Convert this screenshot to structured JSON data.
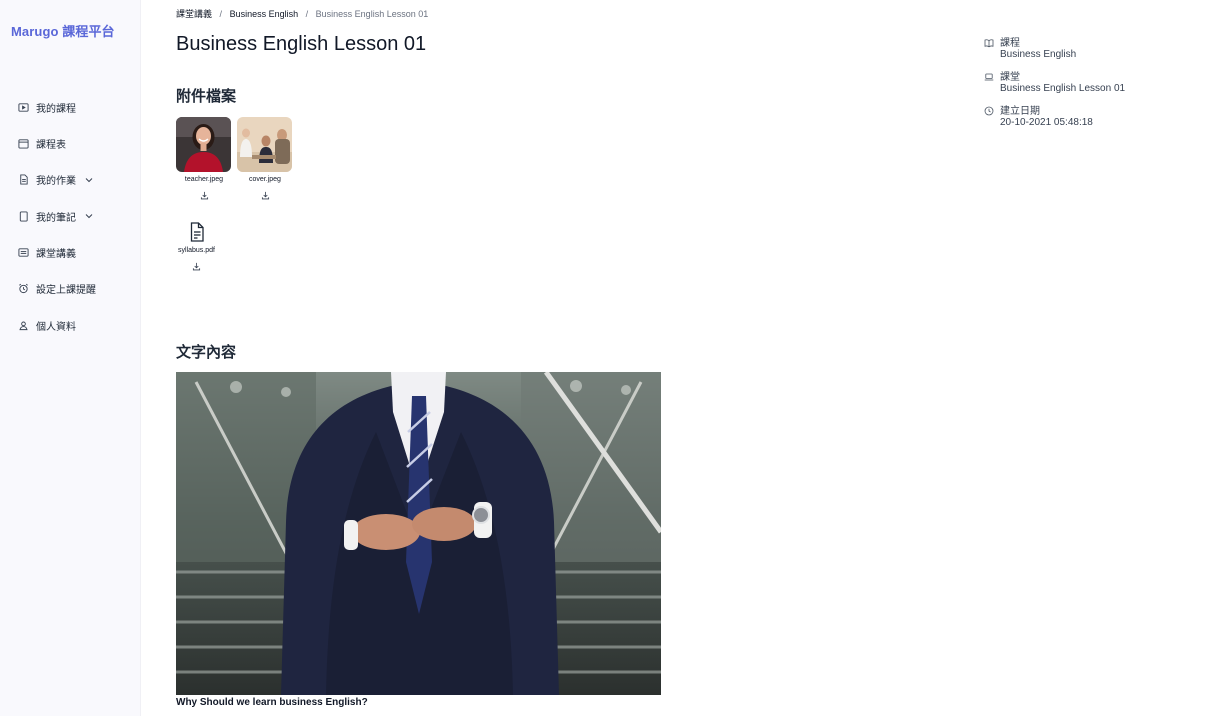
{
  "brand": {
    "name": "Marugo 課程平台",
    "color": "#5a67d8"
  },
  "sidebar": {
    "items": [
      {
        "label": "我的課程",
        "icon": "play-square-icon"
      },
      {
        "label": "課程表",
        "icon": "calendar-icon"
      },
      {
        "label": "我的作業",
        "icon": "document-icon",
        "expandable": true
      },
      {
        "label": "我的筆記",
        "icon": "notebook-icon",
        "expandable": true
      },
      {
        "label": "課堂講義",
        "icon": "list-card-icon"
      },
      {
        "label": "設定上課提醒",
        "icon": "alarm-clock-icon"
      },
      {
        "label": "個人資料",
        "icon": "user-icon"
      }
    ]
  },
  "breadcrumb": {
    "items": [
      "課堂講義",
      "Business English",
      "Business English Lesson 01"
    ],
    "separator": "/"
  },
  "page": {
    "title": "Business English Lesson 01"
  },
  "attachments": {
    "heading": "附件檔案",
    "files": [
      {
        "name": "teacher.jpeg",
        "kind": "image",
        "icon": "photo-thumbnail"
      },
      {
        "name": "cover.jpeg",
        "kind": "image",
        "icon": "photo-thumbnail"
      },
      {
        "name": "syllabus.pdf",
        "kind": "pdf",
        "icon": "file-text-icon"
      }
    ],
    "download_icon": "download-icon"
  },
  "content": {
    "heading": "文字內容",
    "caption": "Why Should we learn business English?"
  },
  "meta": {
    "rows": [
      {
        "label": "課程",
        "value": "Business English",
        "icon": "book-open-icon"
      },
      {
        "label": "課堂",
        "value": "Business English Lesson 01",
        "icon": "laptop-icon"
      },
      {
        "label": "建立日期",
        "value": "20-10-2021 05:48:18",
        "icon": "clock-icon"
      }
    ]
  }
}
